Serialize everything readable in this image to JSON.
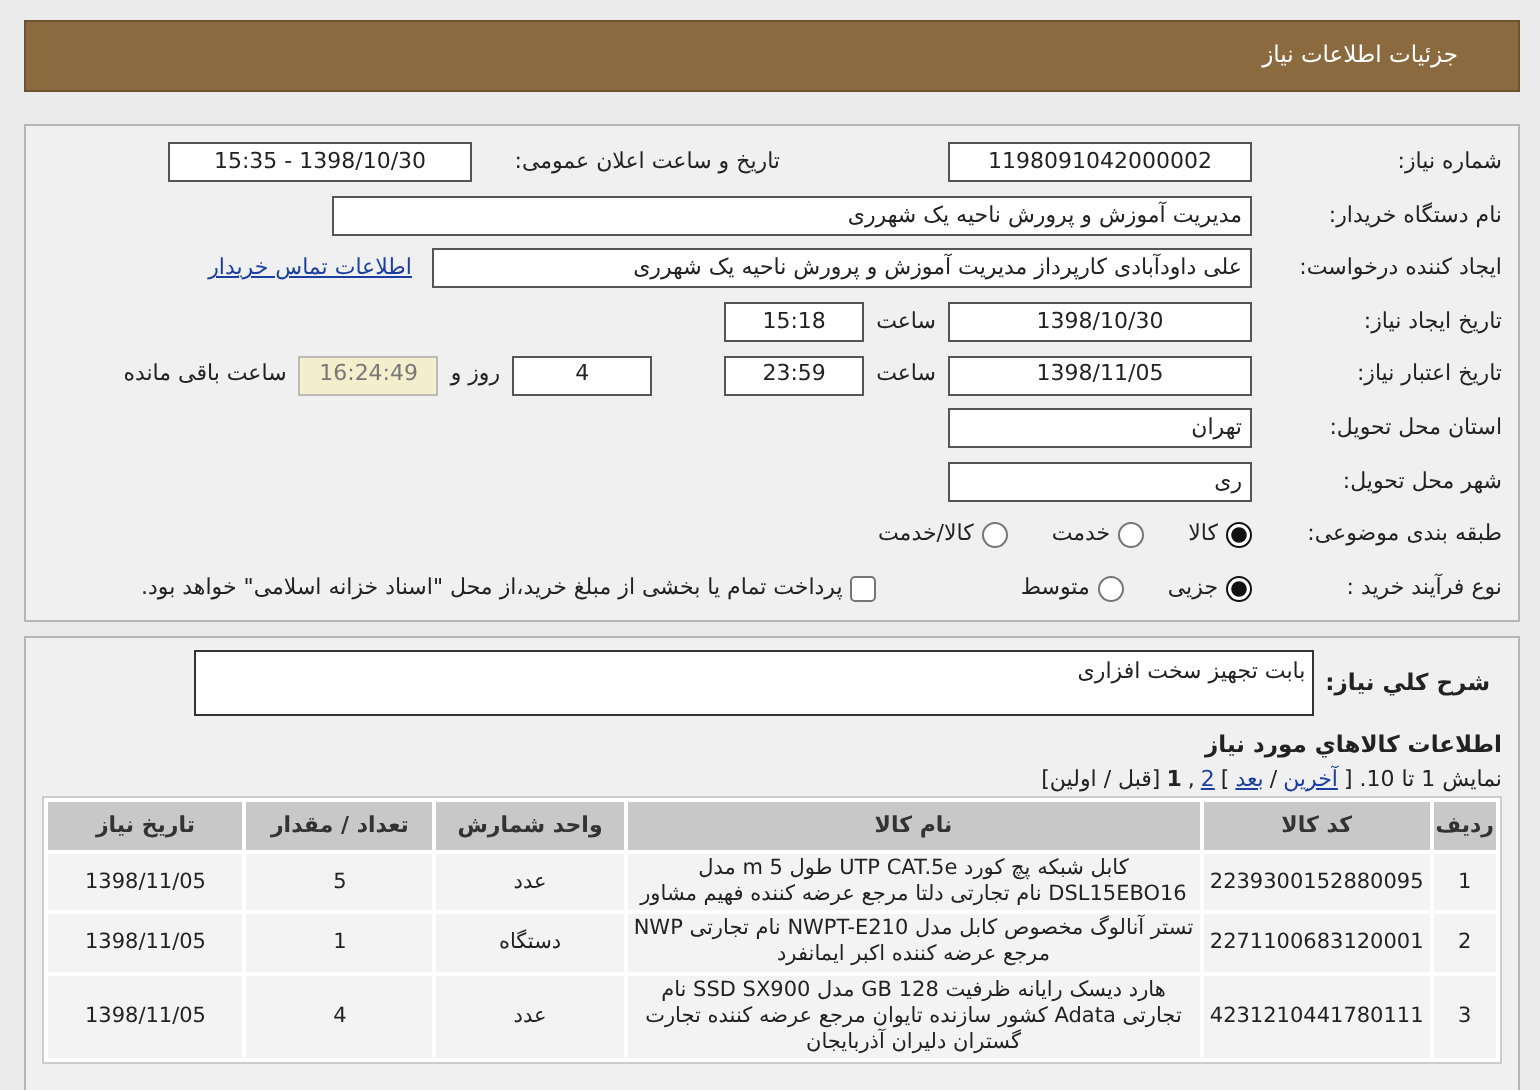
{
  "header": {
    "title": "جزئیات اطلاعات نیاز"
  },
  "details": {
    "need_number": {
      "label": "شماره نیاز:",
      "value": "1198091042000002"
    },
    "announce": {
      "label": "تاریخ و ساعت اعلان عمومی:",
      "value": "1398/10/30 - 15:35"
    },
    "buyer": {
      "label": "نام دستگاه خریدار:",
      "value": "مدیریت آموزش و پرورش ناحیه یک شهرری"
    },
    "creator": {
      "label": "ایجاد کننده درخواست:",
      "value": "علی داودآبادی کارپرداز مدیریت آموزش و پرورش ناحیه یک شهرری",
      "link": "اطلاعات تماس خریدار"
    },
    "created": {
      "label": "تاریخ ایجاد نیاز:",
      "date": "1398/10/30",
      "time_label": "ساعت",
      "time": "15:18"
    },
    "validity": {
      "label": "تاریخ اعتبار نیاز:",
      "date": "1398/11/05",
      "time_label": "ساعت",
      "time": "23:59",
      "days": "4",
      "days_label": "روز و",
      "remaining": "16:24:49",
      "remaining_label": "ساعت باقی مانده"
    },
    "province": {
      "label": "استان محل تحویل:",
      "value": "تهران"
    },
    "city": {
      "label": "شهر محل تحویل:",
      "value": "ری"
    },
    "category": {
      "label": "طبقه بندی موضوعی:",
      "options": [
        {
          "label": "کالا",
          "selected": true
        },
        {
          "label": "خدمت",
          "selected": false
        },
        {
          "label": "کالا/خدمت",
          "selected": false
        }
      ]
    },
    "process": {
      "label": "نوع فرآیند خرید :",
      "options": [
        {
          "label": "جزیی",
          "selected": true
        },
        {
          "label": "متوسط",
          "selected": false
        }
      ],
      "treasury": {
        "label": "پرداخت تمام یا بخشی از مبلغ خرید،از محل \"اسناد خزانه اسلامی\" خواهد بود.",
        "checked": false
      }
    }
  },
  "description": {
    "label": "شرح کلي نیاز:",
    "value": "بابت تجهیز سخت افزاری"
  },
  "goods": {
    "title": "اطلاعات کالاهاي مورد نیاز",
    "pager": [
      {
        "kind": "text",
        "text": "نمایش 1 تا 10. ["
      },
      {
        "kind": "link",
        "text": "آخرین"
      },
      {
        "kind": "text",
        "text": "/"
      },
      {
        "kind": "link",
        "text": "بعد"
      },
      {
        "kind": "text",
        "text": "]"
      },
      {
        "kind": "link",
        "text": "2"
      },
      {
        "kind": "text",
        "text": ","
      },
      {
        "kind": "current",
        "text": "1"
      },
      {
        "kind": "text",
        "text": "[قبل / اولین]"
      }
    ],
    "columns": [
      "ردیف",
      "کد کالا",
      "نام کالا",
      "واحد شمارش",
      "تعداد / مقدار",
      "تاریخ نیاز"
    ],
    "rows": [
      [
        "1",
        "2239300152880095",
        "کابل شبکه پچ کورد UTP CAT.5e طول 5 m مدل DSL15EBO16 نام تجارتی دلتا مرجع عرضه کننده فهیم مشاور",
        "عدد",
        "5",
        "1398/11/05"
      ],
      [
        "2",
        "2271100683120001",
        "تستر آنالوگ مخصوص کابل مدل NWPT-E210 نام تجارتی NWP مرجع عرضه کننده اکبر ایمانفرد",
        "دستگاه",
        "1",
        "1398/11/05"
      ],
      [
        "3",
        "4231210441780111",
        "هارد دیسک رایانه ظرفیت 128 GB مدل SSD SX900 نام تجارتی Adata کشور سازنده تایوان مرجع عرضه کننده تجارت گستران دلیران آذربایجان",
        "عدد",
        "4",
        "1398/11/05"
      ]
    ]
  }
}
